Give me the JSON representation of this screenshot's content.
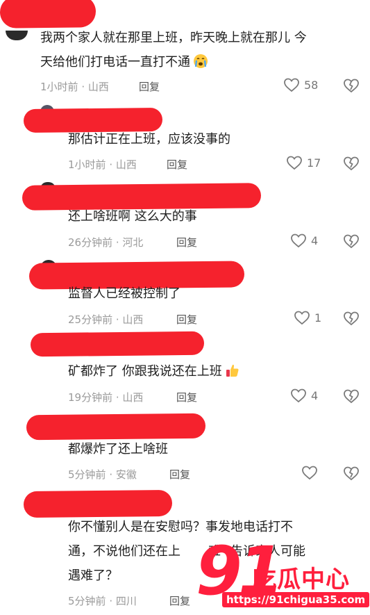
{
  "comments": [
    {
      "text": "我两个家人就在那里上班，昨天晚上就在那儿 今",
      "text2": "天给他们打电话一直打不通",
      "emoji": "crying-face",
      "time": "1小时前",
      "location": "山西",
      "reply_label": "回复",
      "likes": "58"
    },
    {
      "text": "那估计正在上班，应该没事的",
      "time": "1小时前",
      "location": "山西",
      "reply_label": "回复",
      "likes": "17"
    },
    {
      "text": "还上啥班啊 这么大的事",
      "time": "26分钟前",
      "location": "河北",
      "reply_label": "回复",
      "likes": "4"
    },
    {
      "text": "监督人已经被控制了",
      "time": "25分钟前",
      "location": "山西",
      "reply_label": "回复",
      "likes": "1"
    },
    {
      "text": "矿都炸了  你跟我说还在上班",
      "emoji": "thumbs-up",
      "time": "19分钟前",
      "location": "山西",
      "reply_label": "回复",
      "likes": "4"
    },
    {
      "text": "都爆炸了还上啥班",
      "time": "5分钟前",
      "location": "安徽",
      "reply_label": "回复",
      "likes": ""
    },
    {
      "text": "你不懂别人是在安慰吗？事发地电话打不",
      "text2": "通，不说他们还在上",
      "text2b": "难",
      "text2c": "告诉家人可能",
      "text3": "遇难了？",
      "time": "5分钟前",
      "location": "四川",
      "reply_label": "回复",
      "likes": ""
    }
  ],
  "watermark": {
    "number": "91",
    "name": "吃瓜中心",
    "url": "https://91chigua35.com"
  },
  "colors": {
    "redaction": "#f5222d",
    "watermark": "#ff1f3d",
    "meta": "#9a9a9a"
  }
}
